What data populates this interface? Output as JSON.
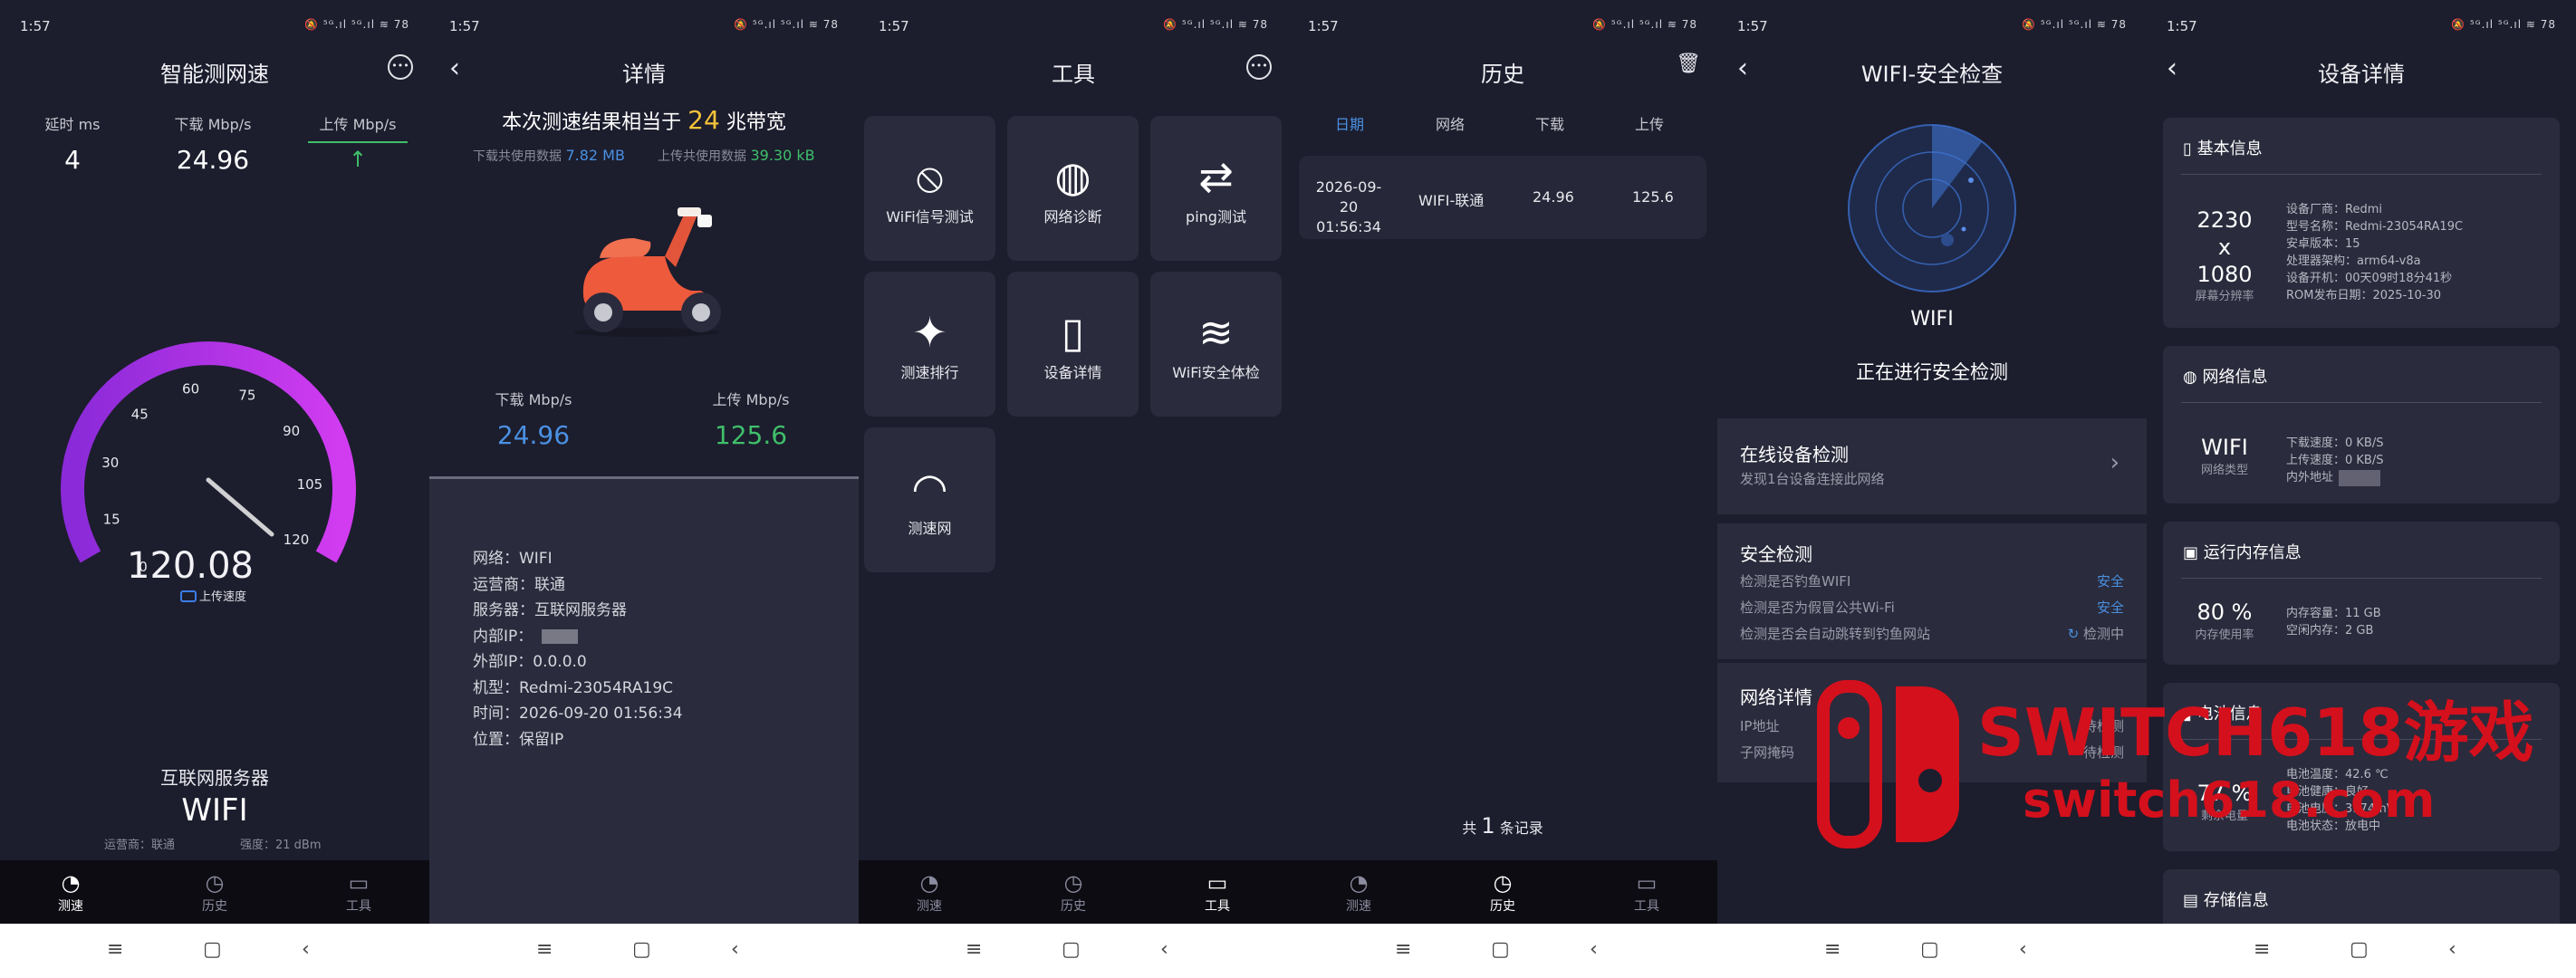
{
  "status": {
    "time": "1:57",
    "icons": "🔕 ⁵ᴳ.ıl ⁵ᴳ.ıl ≋ 78"
  },
  "nav": {
    "speed": "测速",
    "history": "历史",
    "tools": "工具"
  },
  "s1": {
    "title": "智能测网速",
    "latency_label": "延时 ms",
    "latency": "4",
    "down_label": "下载 Mbp/s",
    "down": "24.96",
    "up_label": "上传 Mbp/s",
    "gauge": {
      "value": "120.08",
      "sub": "上传速度",
      "ticks": [
        "0",
        "15",
        "30",
        "45",
        "60",
        "75",
        "90",
        "105",
        "120"
      ],
      "fraction": 1.0
    },
    "server_label": "互联网服务器",
    "network": "WIFI",
    "isp": "运营商：联通",
    "signal": "强度：21 dBm"
  },
  "s2": {
    "title": "详情",
    "headline_pre": "本次测速结果相当于",
    "headline_num": "24",
    "headline_post": "兆带宽",
    "down_used_label": "下载共使用数据",
    "down_used": "7.82 MB",
    "up_used_label": "上传共使用数据",
    "up_used": "39.30 kB",
    "down_label": "下载 Mbp/s",
    "down": "24.96",
    "up_label": "上传 Mbp/s",
    "up": "125.6",
    "info": [
      "网络：WIFI",
      "运营商：联通",
      "服务器：互联网服务器",
      "内部IP：",
      "外部IP：0.0.0.0",
      "机型：Redmi-23054RA19C",
      "时间：2026-09-20 01:56:34",
      "位置：保留IP"
    ]
  },
  "s3": {
    "title": "工具",
    "tiles": [
      "WiFi信号测试",
      "网络诊断",
      "ping测试",
      "测速排行",
      "设备详情",
      "WiFi安全体检",
      "测速网"
    ]
  },
  "s4": {
    "title": "历史",
    "cols": [
      "日期",
      "网络",
      "下载",
      "上传"
    ],
    "row": {
      "date1": "2026-09-20",
      "date2": "01:56:34",
      "net": "WIFI-联通",
      "down": "24.96",
      "up": "125.6"
    },
    "footer_pre": "共",
    "footer_num": "1",
    "footer_post": "条记录"
  },
  "s5": {
    "title": "WIFI-安全检查",
    "net": "WIFI",
    "status": "正在进行安全检测",
    "online_title": "在线设备检测",
    "online_sub": "发现1台设备连接此网络",
    "sec_title": "安全检测",
    "checks": [
      {
        "t": "检测是否钓鱼WIFI",
        "r": "安全"
      },
      {
        "t": "检测是否为假冒公共Wi-Fi",
        "r": "安全"
      },
      {
        "t": "检测是否会自动跳转到钓鱼网站",
        "r": "检测中"
      }
    ],
    "detail_title": "网络详情",
    "ip_label": "IP地址",
    "ip_val": "待检测",
    "mask_label": "子网掩码",
    "mask_val": "待检测"
  },
  "s6": {
    "title": "设备详情",
    "basic": {
      "hd": "基本信息",
      "res1": "2230",
      "resx": "x",
      "res2": "1080",
      "res_label": "屏幕分辨率",
      "lines": [
        "设备厂商：Redmi",
        "型号名称：Redmi-23054RA19C",
        "安卓版本：15",
        "处理器架构：arm64-v8a",
        "设备开机：00天09时18分41秒",
        "ROM发布日期：2025-10-30"
      ]
    },
    "net": {
      "hd": "网络信息",
      "type": "WIFI",
      "type_label": "网络类型",
      "lines": [
        "下载速度：0 KB/S",
        "上传速度：0 KB/S",
        "内外地址"
      ]
    },
    "mem": {
      "hd": "运行内存信息",
      "pct": "80 %",
      "pct_label": "内存使用率",
      "lines": [
        "内存容量：11 GB",
        "空闲内存：2 GB"
      ]
    },
    "bat": {
      "hd": "电池信息",
      "pct": "77 %",
      "pct_label": "剩余电量",
      "lines": [
        "电池温度：42.6 ℃",
        "电池健康：良好",
        "电池电压：3974mV",
        "电池状态：放电中"
      ]
    },
    "storage": {
      "hd": "存储信息"
    }
  },
  "watermark": {
    "line1": "SWITCH618游戏",
    "line2": "switch618.com"
  },
  "colors": {
    "accent_blue": "#4a90e2",
    "accent_green": "#3fbf6a",
    "accent_yellow": "#f5c23a",
    "gauge": "#c43cf0",
    "safe": "#4a90e2",
    "watermark": "#d4101c"
  }
}
